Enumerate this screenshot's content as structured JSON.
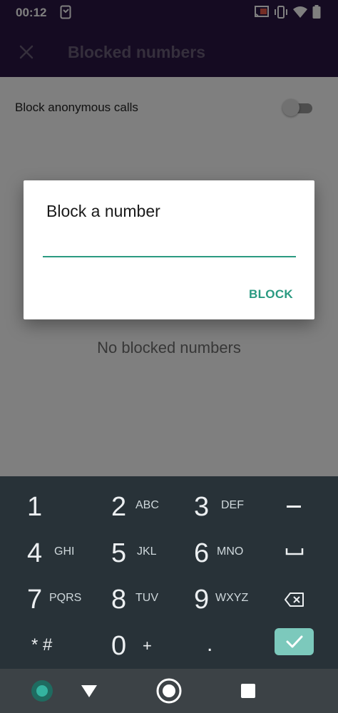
{
  "status_bar": {
    "time": "00:12"
  },
  "app_bar": {
    "title": "Blocked numbers"
  },
  "settings": {
    "block_anonymous_label": "Block anonymous calls",
    "block_anonymous_on": false
  },
  "empty_state": "No blocked numbers",
  "dialog": {
    "title": "Block a number",
    "input_value": "",
    "action_label": "BLOCK"
  },
  "keypad": {
    "keys": [
      {
        "digit": "1",
        "letters": ""
      },
      {
        "digit": "2",
        "letters": "ABC"
      },
      {
        "digit": "3",
        "letters": "DEF"
      },
      {
        "digit": "4",
        "letters": "GHI"
      },
      {
        "digit": "5",
        "letters": "JKL"
      },
      {
        "digit": "6",
        "letters": "MNO"
      },
      {
        "digit": "7",
        "letters": "PQRS"
      },
      {
        "digit": "8",
        "letters": "TUV"
      },
      {
        "digit": "9",
        "letters": "WXYZ"
      },
      {
        "digit": "* #",
        "letters": ""
      },
      {
        "digit": "0",
        "letters": "+"
      },
      {
        "digit": ".",
        "letters": ""
      }
    ],
    "func_keys": [
      "minus-icon",
      "space-icon",
      "backspace-icon",
      "done-check-icon"
    ]
  },
  "colors": {
    "primary_dark": "#2a1645",
    "accent": "#2a9a81",
    "keypad_bg": "#283238",
    "done_key": "#7cc9bc"
  }
}
